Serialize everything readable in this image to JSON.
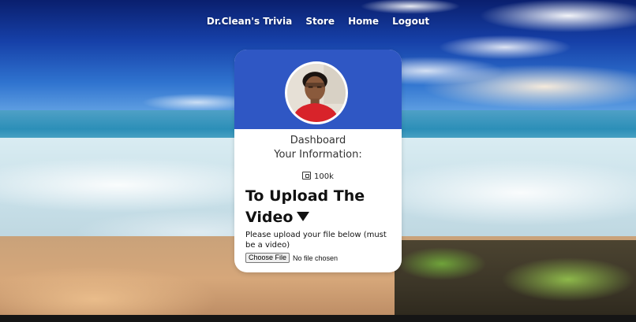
{
  "nav": {
    "items": [
      {
        "label": "Dr.Clean's Trivia"
      },
      {
        "label": "Store"
      },
      {
        "label": "Home"
      },
      {
        "label": "Logout"
      }
    ]
  },
  "card": {
    "header_color": "#2f57c4",
    "avatar": "user-avatar",
    "dashboard_title": "Dashboard",
    "info_title": "Your Information:",
    "coins": {
      "icon": "wallet-icon",
      "value": "100k"
    },
    "upload": {
      "heading": "To Upload The Video",
      "icon": "triangle-down-icon",
      "description": "Please upload your file below (must be a video)",
      "choose_file_label": "Choose File",
      "no_file_label": "No file chosen"
    }
  }
}
